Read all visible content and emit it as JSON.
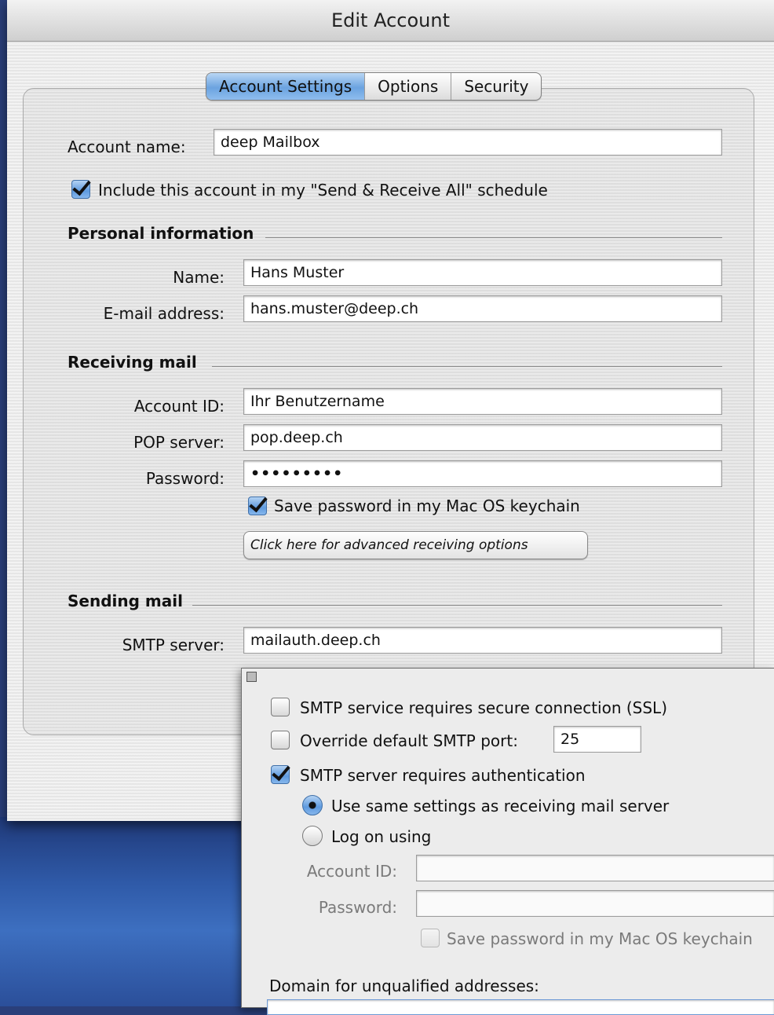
{
  "window": {
    "title": "Edit Account"
  },
  "tabs": [
    {
      "label": "Account Settings",
      "selected": true
    },
    {
      "label": "Options",
      "selected": false
    },
    {
      "label": "Security",
      "selected": false
    }
  ],
  "account": {
    "name_label": "Account name:",
    "name_value": "deep Mailbox",
    "include_label": "Include this account in my \"Send & Receive All\" schedule",
    "include_checked": true
  },
  "personal": {
    "heading": "Personal information",
    "name_label": "Name:",
    "name_value": "Hans Muster",
    "email_label": "E-mail address:",
    "email_value": "hans.muster@deep.ch"
  },
  "receiving": {
    "heading": "Receiving mail",
    "account_id_label": "Account ID:",
    "account_id_value": "Ihr Benutzername",
    "pop_label": "POP server:",
    "pop_value": "pop.deep.ch",
    "password_label": "Password:",
    "password_value": "•••••••••",
    "save_password_label": "Save password in my Mac OS keychain",
    "save_password_checked": true,
    "advanced_button": "Click here for advanced receiving options"
  },
  "sending": {
    "heading": "Sending mail",
    "smtp_label": "SMTP server:",
    "smtp_value": "mailauth.deep.ch"
  },
  "smtp_panel": {
    "ssl_label": "SMTP service requires secure connection (SSL)",
    "ssl_checked": false,
    "override_label": "Override default SMTP port:",
    "override_checked": false,
    "port_value": "25",
    "auth_label": "SMTP server requires authentication",
    "auth_checked": true,
    "same_settings_label": "Use same settings as receiving mail server",
    "same_settings_selected": true,
    "logon_label": "Log on using",
    "logon_selected": false,
    "account_id_label": "Account ID:",
    "account_id_value": "",
    "password_label": "Password:",
    "password_value": "",
    "save_password_label": "Save password in my Mac OS keychain",
    "domain_label": "Domain for unqualified addresses:"
  }
}
